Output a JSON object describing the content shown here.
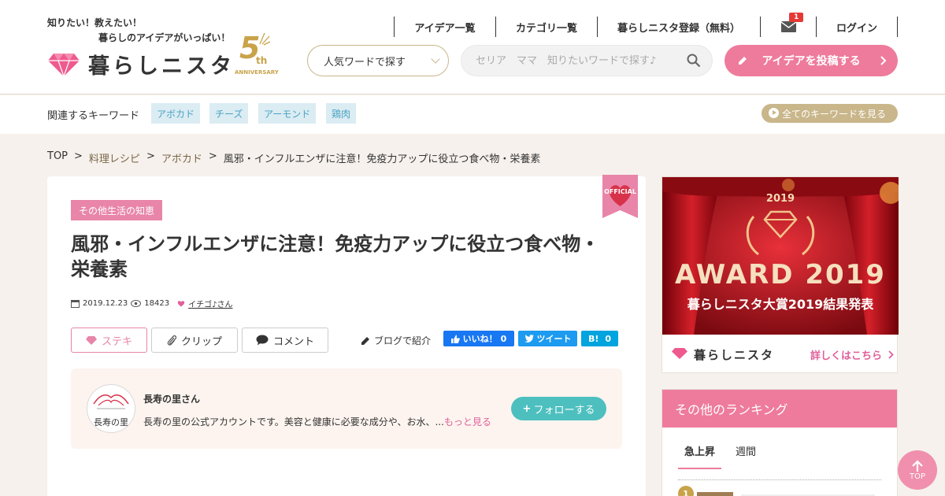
{
  "header": {
    "tagline1": "知りたい！教えたい！",
    "tagline2": "暮らしのアイデアがいっぱい！",
    "site_name": "暮らしニスタ",
    "anniversary_num": "5",
    "anniversary_suffix": "th",
    "anniversary_word": "ANNIVERSARY",
    "nav": [
      {
        "label": "アイデア一覧"
      },
      {
        "label": "カテゴリ一覧"
      },
      {
        "label": "暮らしニスタ登録（無料）"
      },
      {
        "label": ""
      },
      {
        "label": "ログイン"
      }
    ],
    "mail_badge": "1",
    "popular_select": "人気ワードで探す",
    "search_placeholder": "セリア　ママ　知りたいワードで探す♪",
    "post_button": "アイデアを投稿する"
  },
  "keywords": {
    "label": "関連するキーワード",
    "tags": [
      "アボカド",
      "チーズ",
      "アーモンド",
      "鶏肉"
    ],
    "all_label": "全てのキーワードを見る"
  },
  "breadcrumb": {
    "items": [
      "TOP",
      "料理レシピ",
      "アボカド",
      "風邪・インフルエンザに注意！免疫力アップに役立つ食べ物・栄養素"
    ],
    "separator": ">"
  },
  "article": {
    "official_label": "OFFICIAL",
    "category": "その他生活の知恵",
    "title": "風邪・インフルエンザに注意！免疫力アップに役立つ食べ物・栄養素",
    "date": "2019.12.23",
    "views": "18423",
    "author": "イチゴ♪さん",
    "actions": {
      "steki": "ステキ",
      "clip": "クリップ",
      "comment": "コメント"
    },
    "blog_label": "ブログで紹介",
    "sns": {
      "like_label": "いいね！",
      "like_count": "0",
      "tweet_label": "ツイート",
      "hatena_label": "B!",
      "hatena_count": "0"
    },
    "profile": {
      "avatar_text": "長寿の里",
      "name": "長寿の里さん",
      "description": "長寿の里の公式アカウントです。美容と健康に必要な成分や、お水、...",
      "more": "もっと見る",
      "follow": "フォローする"
    }
  },
  "sidebar": {
    "award": {
      "year": "2019",
      "title": "AWARD 2019",
      "subtitle": "暮らしニスタ大賞2019結果発表",
      "brand": "暮らしニスタ",
      "more": "詳しくはこちら"
    },
    "ranking": {
      "heading": "その他のランキング",
      "tabs": [
        "急上昇",
        "週間"
      ],
      "first_rank": "1"
    }
  },
  "to_top": "TOP",
  "colors": {
    "brand_pink": "#ee7b9c",
    "gold": "#c9b68a",
    "teal": "#4dbfbf"
  }
}
